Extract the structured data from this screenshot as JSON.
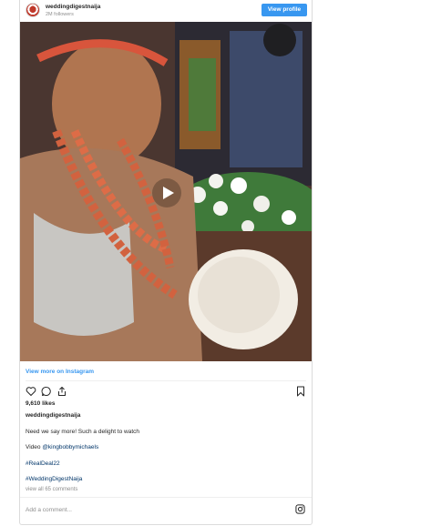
{
  "header": {
    "username": "weddingdigestnaija",
    "followers": "2M followers",
    "view_profile_label": "View profile"
  },
  "media": {
    "type": "video",
    "play_icon": "play-icon"
  },
  "view_more_label": "View more on Instagram",
  "actions": {
    "like_icon": "heart-icon",
    "comment_icon": "comment-icon",
    "share_icon": "share-icon",
    "save_icon": "bookmark-icon"
  },
  "likes": "9,610 likes",
  "caption": {
    "username": "weddingdigestnaija",
    "line1": "Need we say more! Such a delight to watch",
    "line2_prefix": "Video ",
    "line2_mention": "@kingbobbymichaels",
    "hashtag1": "#RealDeal22",
    "hashtag2": "#WeddingDigestNaija"
  },
  "view_comments": "view all 65 comments",
  "add_comment_placeholder": "Add a comment...",
  "colors": {
    "accent": "#3897f0",
    "link": "#003569",
    "muted": "#8e8e8e"
  }
}
